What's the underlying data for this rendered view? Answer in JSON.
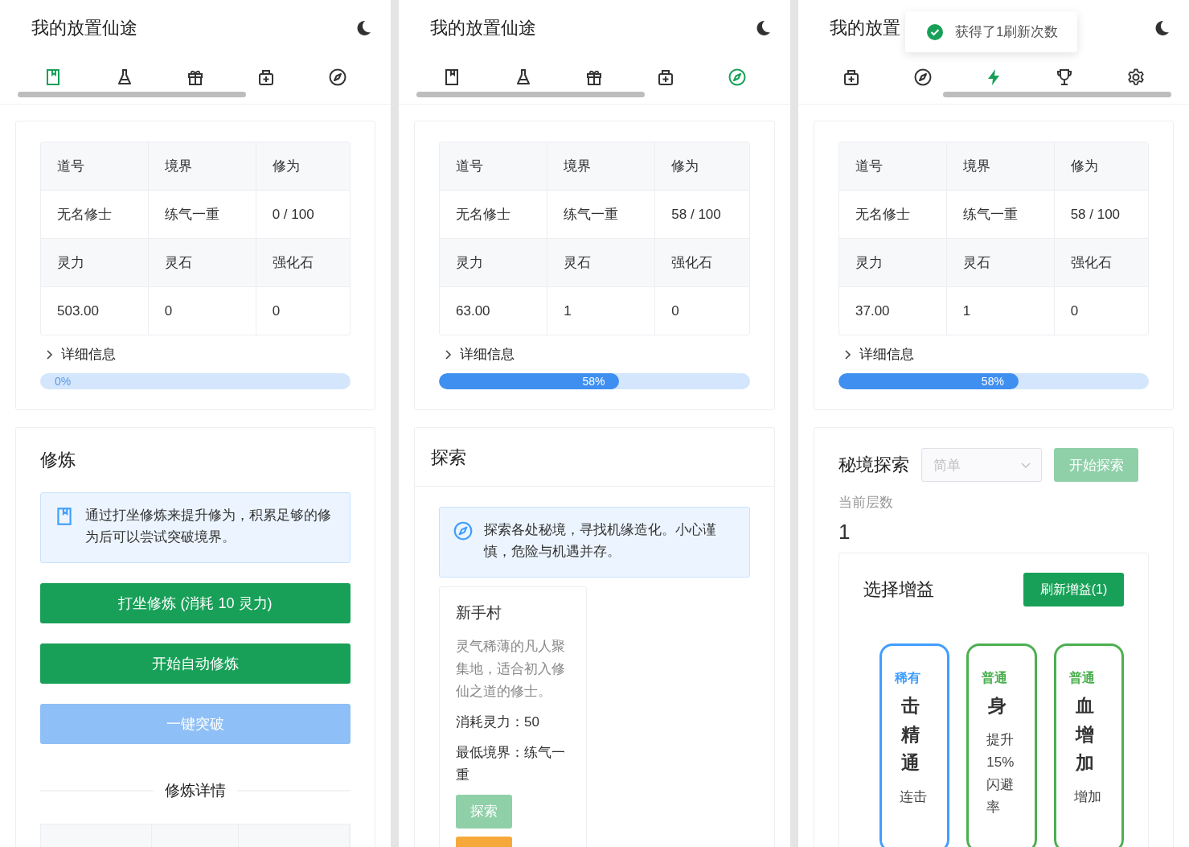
{
  "panels": [
    {
      "title": "我的放置仙途",
      "tabs_scrolled_end": false,
      "tabs": [
        {
          "kind": "book",
          "selected": true
        },
        {
          "kind": "flask",
          "selected": false
        },
        {
          "kind": "gift",
          "selected": false
        },
        {
          "kind": "medkit",
          "selected": false
        },
        {
          "kind": "compass",
          "selected": false
        }
      ],
      "stats": [
        {
          "kind": "header",
          "cells": [
            "道号",
            "境界",
            "修为"
          ]
        },
        {
          "kind": "value",
          "cells": [
            "无名修士",
            "练气一重",
            "0 / 100"
          ]
        },
        {
          "kind": "header",
          "cells": [
            "灵力",
            "灵石",
            "强化石"
          ]
        },
        {
          "kind": "value",
          "cells": [
            "503.00",
            "0",
            "0"
          ]
        }
      ],
      "details": {
        "label": "详细信息",
        "expanded": false
      },
      "progress": {
        "level": 0,
        "label": "0%"
      },
      "section": {
        "kind": "cultivate",
        "title": "修炼",
        "notice": "通过打坐修炼来提升修为，积累足够的修为后可以尝试突破境界。",
        "buttons": [
          {
            "label": "打坐修炼 (消耗 10 灵力)",
            "disabled": false,
            "kind": "success"
          },
          {
            "label": "开始自动修炼",
            "disabled": false,
            "kind": "success"
          },
          {
            "label": "一键突破",
            "disabled": true,
            "kind": "primary"
          }
        ],
        "divider_title": "修炼详情"
      }
    },
    {
      "title": "我的放置仙途",
      "tabs_scrolled_end": false,
      "tabs": [
        {
          "kind": "book",
          "selected": false
        },
        {
          "kind": "flask",
          "selected": false
        },
        {
          "kind": "gift",
          "selected": false
        },
        {
          "kind": "medkit",
          "selected": false
        },
        {
          "kind": "compass",
          "selected": true
        }
      ],
      "stats": [
        {
          "kind": "header",
          "cells": [
            "道号",
            "境界",
            "修为"
          ]
        },
        {
          "kind": "value",
          "cells": [
            "无名修士",
            "练气一重",
            "58 / 100"
          ]
        },
        {
          "kind": "header",
          "cells": [
            "灵力",
            "灵石",
            "强化石"
          ]
        },
        {
          "kind": "value",
          "cells": [
            "63.00",
            "1",
            "0"
          ]
        }
      ],
      "details": {
        "label": "详细信息",
        "expanded": false
      },
      "progress": {
        "level": 0.58,
        "label": "58%"
      },
      "section": {
        "kind": "explore",
        "title": "探索",
        "notice": "探索各处秘境，寻找机缘造化。小心谨慎，危险与机遇并存。",
        "locations": [
          {
            "name": "新手村",
            "description": "灵气稀薄的凡人聚集地，适合初入修仙之道的修士。",
            "cost": "消耗灵力：50",
            "min_realm": "最低境界：练气一重",
            "buttons": [
              {
                "kind": "success",
                "label": "探索",
                "disabled": true
              },
              {
                "kind": "warning",
                "disabled": false
              }
            ]
          }
        ]
      }
    },
    {
      "title": "我的放置",
      "tabs_scrolled_end": true,
      "tabs": [
        {
          "kind": "medkit",
          "selected": false
        },
        {
          "kind": "compass",
          "selected": false
        },
        {
          "kind": "bolt",
          "selected": true
        },
        {
          "kind": "trophy",
          "selected": false
        },
        {
          "kind": "gear",
          "selected": false
        }
      ],
      "toast": {
        "text": "获得了1刷新次数"
      },
      "stats": [
        {
          "kind": "header",
          "cells": [
            "道号",
            "境界",
            "修为"
          ]
        },
        {
          "kind": "value",
          "cells": [
            "无名修士",
            "练气一重",
            "58 / 100"
          ]
        },
        {
          "kind": "header",
          "cells": [
            "灵力",
            "灵石",
            "强化石"
          ]
        },
        {
          "kind": "value",
          "cells": [
            "37.00",
            "1",
            "0"
          ]
        }
      ],
      "details": {
        "label": "详细信息",
        "expanded": false
      },
      "progress": {
        "level": 0.58,
        "label": "58%"
      },
      "section": {
        "kind": "dungeon",
        "title": "秘境探索",
        "select": {
          "placeholder": "简单",
          "disabled": true
        },
        "start_button": {
          "label": "开始探索",
          "disabled": true
        },
        "floor_label": "当前层数",
        "floor_value": "1",
        "buff_panel": {
          "title": "选择增益",
          "refresh_button": {
            "label": "刷新增益(1)"
          },
          "buffs": [
            {
              "rarity": "稀有",
              "color": "#409eff",
              "name": "击精通",
              "description": "连击"
            },
            {
              "rarity": "普通",
              "color": "#4caf50",
              "name": "身",
              "description": "提升15%闪避率"
            },
            {
              "rarity": "普通",
              "color": "#4caf50",
              "name": "血增加",
              "description": "增加"
            }
          ]
        }
      }
    }
  ]
}
